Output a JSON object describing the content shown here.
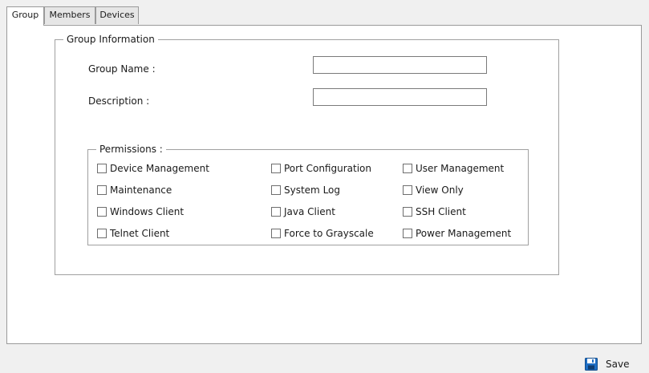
{
  "tabs": [
    {
      "label": "Group",
      "active": true
    },
    {
      "label": "Members",
      "active": false
    },
    {
      "label": "Devices",
      "active": false
    }
  ],
  "group_info": {
    "legend": "Group Information",
    "group_name_label": "Group Name :",
    "group_name_value": "",
    "description_label": "Description :",
    "description_value": ""
  },
  "permissions": {
    "legend": "Permissions :",
    "items": [
      {
        "label": "Device Management",
        "checked": false
      },
      {
        "label": "Port Configuration",
        "checked": false
      },
      {
        "label": "User Management",
        "checked": false
      },
      {
        "label": "Maintenance",
        "checked": false
      },
      {
        "label": "System Log",
        "checked": false
      },
      {
        "label": "View Only",
        "checked": false
      },
      {
        "label": "Windows Client",
        "checked": false
      },
      {
        "label": "Java Client",
        "checked": false
      },
      {
        "label": "SSH Client",
        "checked": false
      },
      {
        "label": "Telnet Client",
        "checked": false
      },
      {
        "label": "Force to Grayscale",
        "checked": false
      },
      {
        "label": "Power Management",
        "checked": false
      }
    ]
  },
  "actions": {
    "save_label": "Save",
    "save_icon": "floppy-disk-icon"
  },
  "colors": {
    "accent": "#1f6fc5"
  }
}
